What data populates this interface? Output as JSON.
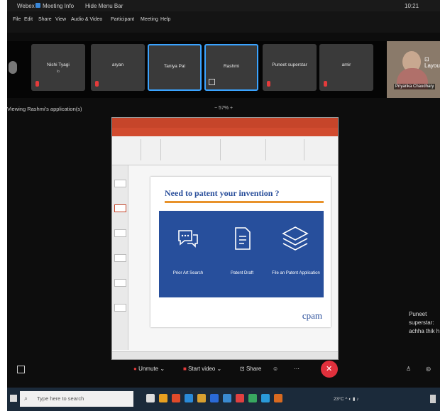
{
  "titlebar": {
    "app": "Webex",
    "meeting_info": "Meeting Info",
    "hide_menu": "Hide Menu Bar",
    "time": "10:21"
  },
  "menu": [
    "File",
    "Edit",
    "Share",
    "View",
    "Audio & Video",
    "Participant",
    "Meeting",
    "Help"
  ],
  "participants": [
    {
      "name": "Nishi Tyagi",
      "sub": "lo"
    },
    {
      "name": "aryan",
      "sub": ""
    },
    {
      "name": "Taniya Pal",
      "sub": ""
    },
    {
      "name": "Rashmi",
      "sub": ""
    },
    {
      "name": "Puneet superstar",
      "sub": ""
    },
    {
      "name": "amir",
      "sub": ""
    }
  ],
  "self_view": {
    "name": "Priyanka Chaudhary"
  },
  "layout_button": "Layout",
  "viewing": "Viewing Rashmi's application(s)",
  "zoom_level": "57%",
  "slide": {
    "heading": "Need to patent your invention ?",
    "features": [
      {
        "label": "Prior Art Search",
        "icon": "chat-bubbles-icon"
      },
      {
        "label": "Patent Draft",
        "icon": "document-icon"
      },
      {
        "label": "File an Patent Application",
        "icon": "layers-icon"
      }
    ],
    "logo": "cpam"
  },
  "chat": {
    "lines": [
      "Puneet",
      "superstar:",
      "achha thik h"
    ]
  },
  "controls": {
    "unmute": "Unmute",
    "start_video": "Start video",
    "share": "Share"
  },
  "taskbar": {
    "search_placeholder": "Type here to search",
    "weather": "23°C"
  },
  "colors": {
    "accent_blue": "#3aa3ff",
    "slide_blue": "#274f9c",
    "end_red": "#e0303c",
    "ppt_orange": "#c6452a"
  }
}
